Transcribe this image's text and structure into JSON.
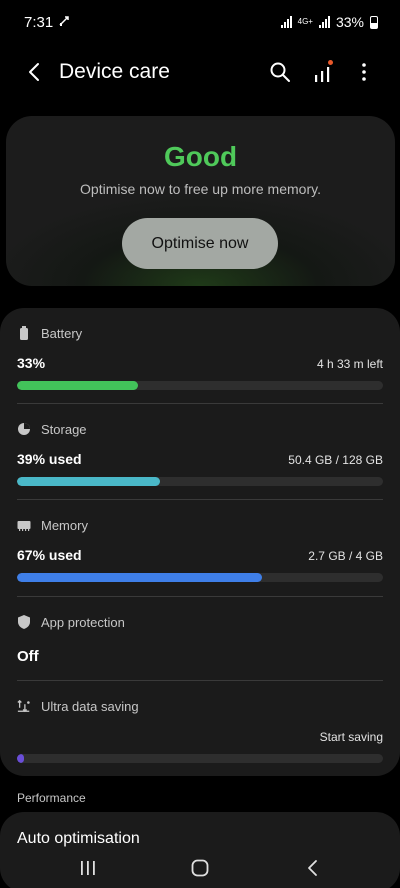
{
  "status_bar": {
    "time": "7:31",
    "network_type": "4G+",
    "battery_percent": "33%",
    "icons": [
      "data-saver-icon",
      "wifi-calling-signal-icon",
      "signal-icon",
      "signal-icon-sim2",
      "battery-icon"
    ]
  },
  "header": {
    "title": "Device care",
    "icons": [
      "back-icon",
      "search-icon",
      "stats-icon",
      "more-icon"
    ],
    "accent_dot_color": "#e8582a"
  },
  "status_card": {
    "status": "Good",
    "status_color": "#4fc95a",
    "message": "Optimise now to free up more memory.",
    "button_label": "Optimise now"
  },
  "metrics": {
    "battery": {
      "label": "Battery",
      "value": "33%",
      "detail": "4 h 33 m left",
      "level": 0.33,
      "color": "#42c25a",
      "icon": "battery-icon"
    },
    "storage": {
      "label": "Storage",
      "value": "39% used",
      "detail": "50.4 GB / 128 GB",
      "level": 0.39,
      "color": "#4ab8c8",
      "icon": "storage-pie-icon"
    },
    "memory": {
      "label": "Memory",
      "value": "67% used",
      "detail": "2.7 GB / 4 GB",
      "level": 0.67,
      "color": "#3f7fe8",
      "icon": "memory-chip-icon"
    },
    "app_protection": {
      "label": "App protection",
      "value": "Off",
      "icon": "shield-icon"
    },
    "ultra_data_saving": {
      "label": "Ultra data saving",
      "action": "Start saving",
      "level": 0.02,
      "color": "#6a4ed8",
      "icon": "data-saving-icon"
    }
  },
  "sections": {
    "performance_label": "Performance",
    "auto_optimisation_label": "Auto optimisation"
  },
  "nav_bar": {
    "icons": [
      "recents-icon",
      "home-icon",
      "back-nav-icon"
    ]
  }
}
